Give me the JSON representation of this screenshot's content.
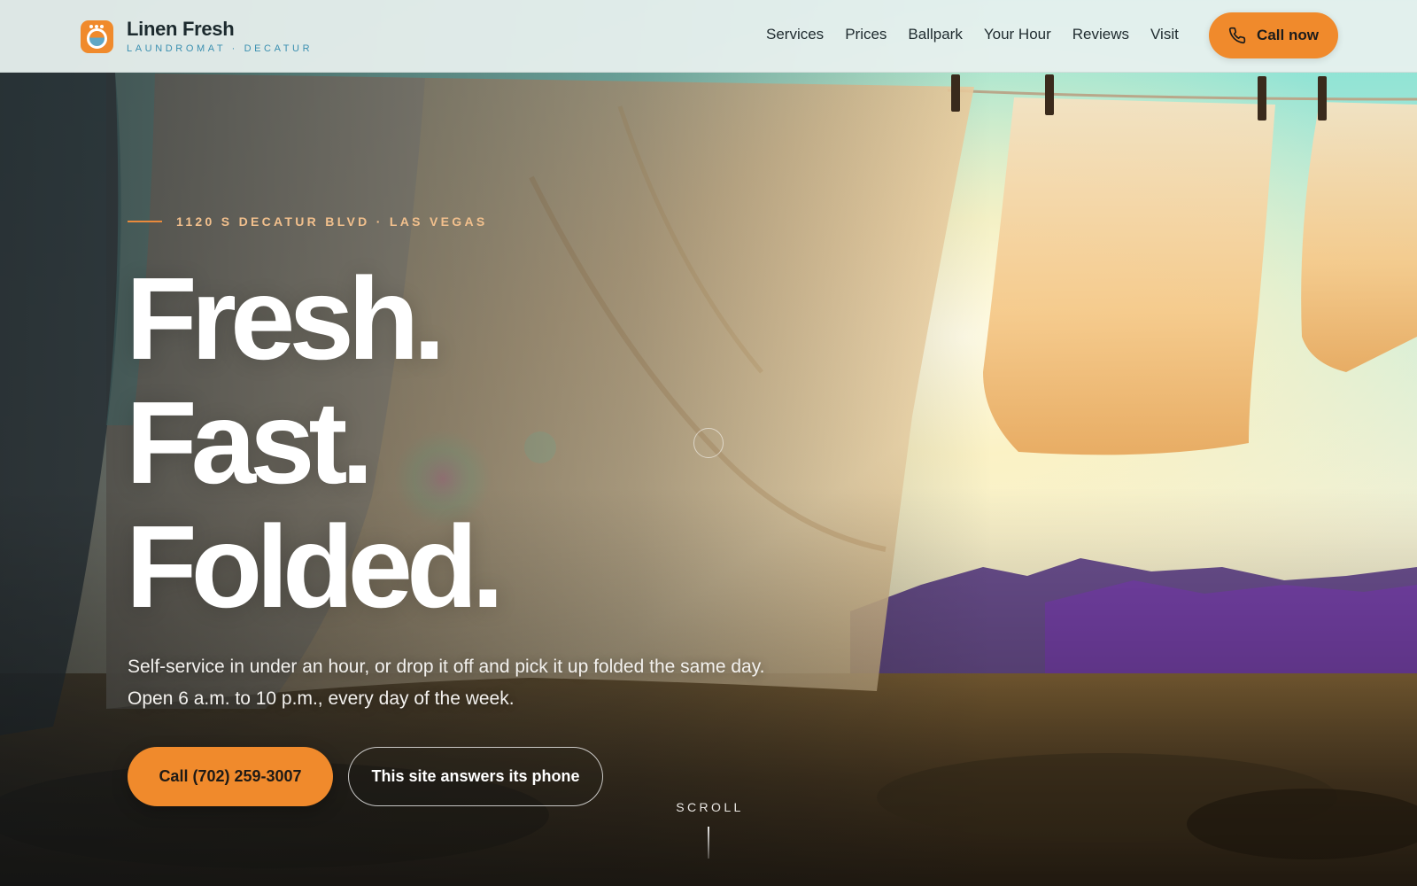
{
  "brand": {
    "name": "Linen Fresh",
    "tagline": "LAUNDROMAT · DECATUR",
    "accent_color": "#f08a2c",
    "secondary_color": "#3a8fb0"
  },
  "nav": {
    "items": [
      {
        "label": "Services"
      },
      {
        "label": "Prices"
      },
      {
        "label": "Ballpark"
      },
      {
        "label": "Your Hour"
      },
      {
        "label": "Reviews"
      },
      {
        "label": "Visit"
      }
    ],
    "call_now": {
      "label": "Call now",
      "icon": "phone-icon"
    }
  },
  "hero": {
    "eyebrow": "1120 S DECATUR BLVD · LAS VEGAS",
    "headline": [
      "Fresh.",
      "Fast.",
      "Folded."
    ],
    "subtext": "Self-service in under an hour, or drop it off and pick it up folded the same day. Open 6 a.m. to 10 p.m., every day of the week.",
    "primary_cta": "Call (702) 259-3007",
    "secondary_cta": "This site answers its phone",
    "scroll_label": "SCROLL"
  }
}
